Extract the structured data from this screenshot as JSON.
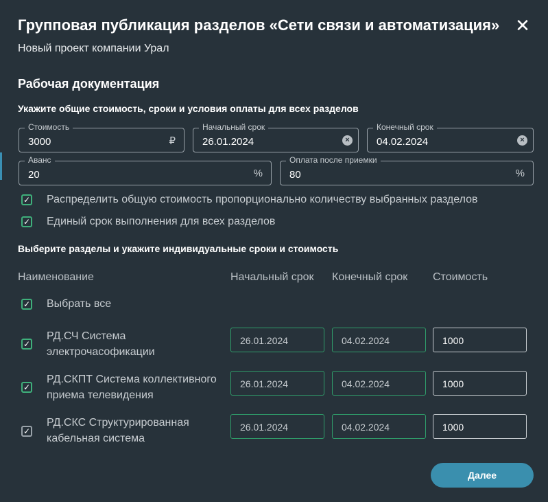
{
  "dialog": {
    "title": "Групповая публикация разделов «Сети связи и автоматизация»",
    "subtitle": "Новый проект компании Урал",
    "close_icon": "close-icon",
    "section_title": "Рабочая документация",
    "common_heading": "Укажите общие стоимость, сроки и условия оплаты для всех разделов",
    "fields": {
      "cost": {
        "label": "Стоимость",
        "value": "3000",
        "suffix": "₽"
      },
      "start": {
        "label": "Начальный срок",
        "value": "26.01.2024"
      },
      "end": {
        "label": "Конечный срок",
        "value": "04.02.2024"
      },
      "advance": {
        "label": "Аванс",
        "value": "20",
        "suffix": "%"
      },
      "after_accept": {
        "label": "Оплата после приемки",
        "value": "80",
        "suffix": "%"
      }
    },
    "options": {
      "distribute": "Распределить общую стоимость пропорционально количеству выбранных разделов",
      "single_deadline": "Единый срок выполнения для всех разделов"
    },
    "sections_heading": "Выберите разделы и укажите индивидуальные сроки и стоимость",
    "columns": {
      "name": "Наименование",
      "start": "Начальный срок",
      "end": "Конечный срок",
      "cost": "Стоимость"
    },
    "select_all": "Выбрать все",
    "rows": [
      {
        "line1": "РД.СЧ Система",
        "line2": "электрочасофикации",
        "start": "26.01.2024",
        "end": "04.02.2024",
        "cost": "1000"
      },
      {
        "line1": "РД.СКПТ Система коллективного",
        "line2": "приема телевидения",
        "start": "26.01.2024",
        "end": "04.02.2024",
        "cost": "1000"
      },
      {
        "line1": "РД.СКС Структурированная",
        "line2": "кабельная система",
        "start": "26.01.2024",
        "end": "04.02.2024",
        "cost": "1000"
      }
    ],
    "next_button": "Далее",
    "colors": {
      "accent": "#3a8fae",
      "check": "#3fb07b",
      "bg": "#27323a"
    }
  }
}
